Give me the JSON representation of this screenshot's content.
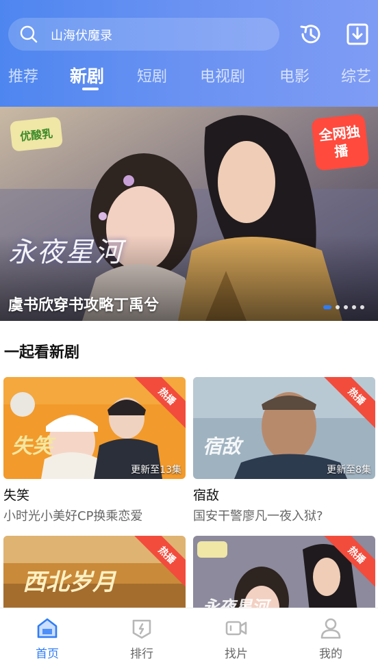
{
  "search": {
    "text": "山海伏魔录",
    "icon": "search-icon"
  },
  "header_actions": [
    {
      "icon": "history-icon"
    },
    {
      "icon": "download-icon"
    }
  ],
  "tabs": [
    {
      "label": "推荐"
    },
    {
      "label": "新剧",
      "active": true
    },
    {
      "label": "短剧"
    },
    {
      "label": "电视剧"
    },
    {
      "label": "电影"
    },
    {
      "label": "综艺"
    }
  ],
  "banner": {
    "title": "虞书欣穿书攻略丁禹兮",
    "brand_badge": "优酸乳",
    "exclusive_badge": "全网独播",
    "show_logo": "永夜星河",
    "dots_total": 5,
    "dots_active_index": 0
  },
  "section": {
    "title": "一起看新剧"
  },
  "cards": [
    {
      "title": "失笑",
      "desc": "小时光小美好CP换乘恋爱",
      "badge": "热播",
      "update": "更新至13集",
      "logo": "失笑"
    },
    {
      "title": "宿敌",
      "desc": "国安干警廖凡一夜入狱?",
      "badge": "热播",
      "update": "更新至8集",
      "logo": "宿敌"
    },
    {
      "badge": "热播",
      "logo": "西北岁月"
    },
    {
      "badge": "热播",
      "logo": "永夜星河"
    }
  ],
  "bottom_nav": [
    {
      "label": "首页",
      "icon": "home-icon",
      "active": true
    },
    {
      "label": "排行",
      "icon": "ranking-icon"
    },
    {
      "label": "找片",
      "icon": "video-camera-icon"
    },
    {
      "label": "我的",
      "icon": "profile-icon"
    }
  ],
  "colors": {
    "header_start": "#4e86f0",
    "header_end": "#7f9cf4",
    "accent": "#2f7cf6",
    "hot_badge": "#f24c3d"
  }
}
